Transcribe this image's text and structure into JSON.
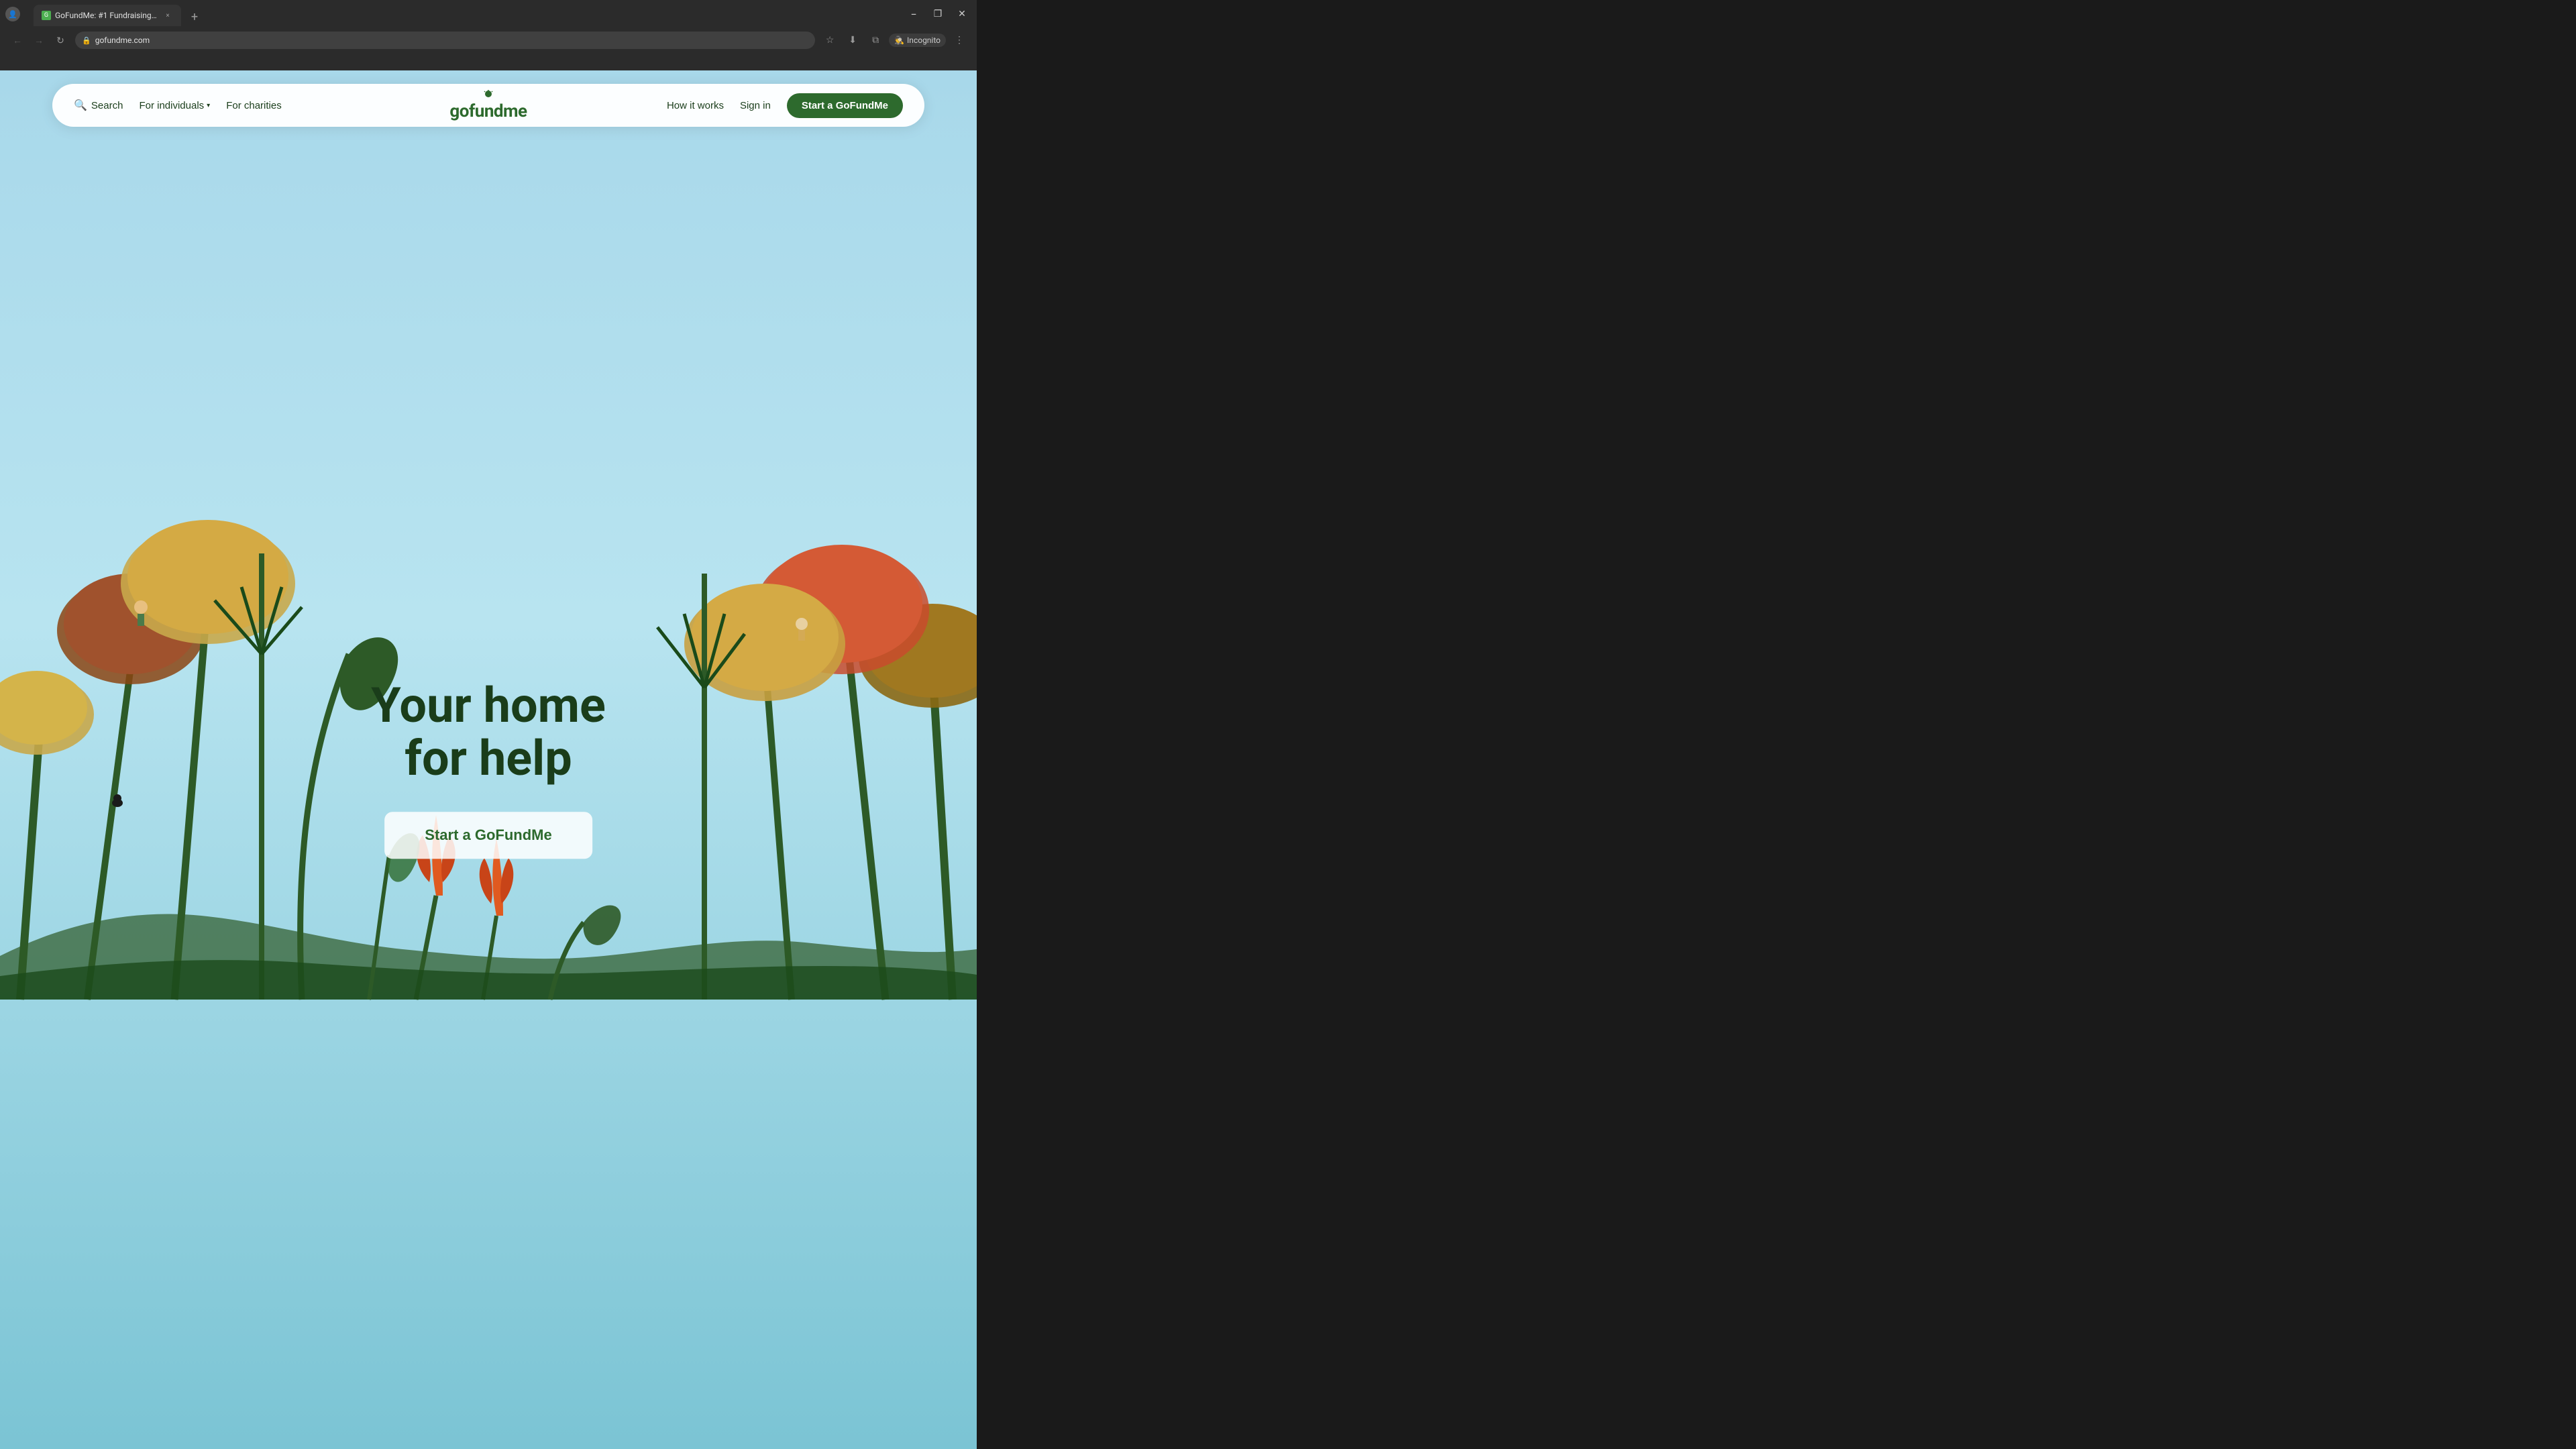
{
  "browser": {
    "tab_title": "GoFundMe: #1 Fundraising Pla...",
    "tab_new_label": "+",
    "tab_close_label": "×",
    "url": "gofundme.com",
    "incognito_label": "Incognito",
    "window_controls": {
      "minimize": "−",
      "maximize": "❐",
      "close": "✕"
    }
  },
  "navbar": {
    "search_label": "Search",
    "for_individuals_label": "For individuals",
    "for_charities_label": "For charities",
    "how_it_works_label": "How it works",
    "sign_in_label": "Sign in",
    "start_button_label": "Start a GoFundMe",
    "logo_text": "gofundme"
  },
  "hero": {
    "title_line1": "Your home",
    "title_line2": "for help",
    "cta_label": "Start a GoFundMe"
  },
  "colors": {
    "brand_green": "#2d6a2d",
    "dark_green": "#1a3d1a",
    "sky_blue": "#87ceeb",
    "hero_bg": "#a8d8ea"
  }
}
